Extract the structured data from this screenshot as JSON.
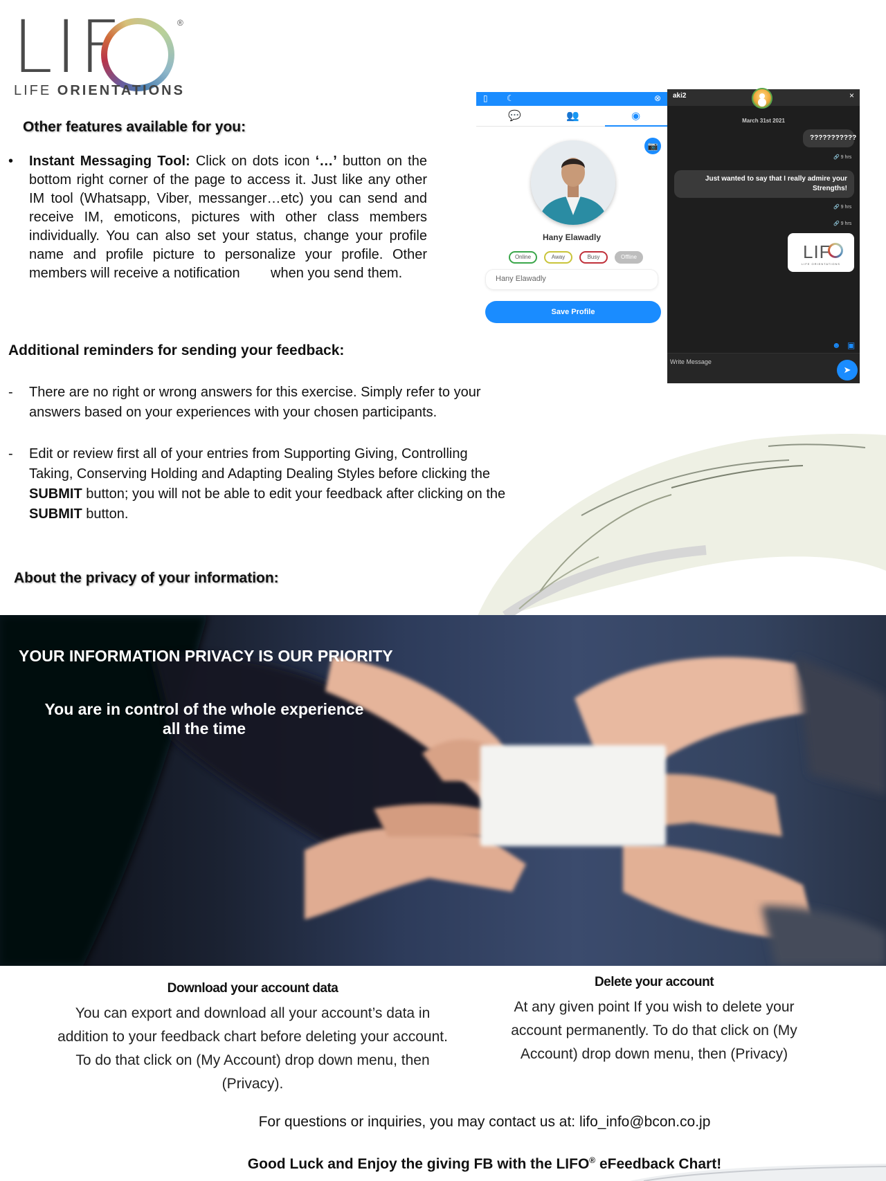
{
  "logo": {
    "letters": "LIF",
    "registered": "®",
    "subtitle_light": "LIFE ",
    "subtitle_bold": "ORIENTATIONS"
  },
  "features": {
    "title": "Other features available for you:",
    "bullet": "•",
    "im_label": "Instant Messaging Tool:",
    "im_text_1": " Click on dots icon  ",
    "im_dots": "‘…’",
    "im_text_2": " button on the bottom right corner of the page to access it. Just like any other IM tool (Whatsapp, Viber, messanger…etc) you can send and receive IM, emoticons, pictures with other class members individually. You can also set your status, change your profile name and profile picture to personalize your profile. Other members will receive a notification        when you send them."
  },
  "profile_mock": {
    "name": "Hany Elawadly",
    "statuses": [
      "Online",
      "Away",
      "Busy",
      "Offline"
    ],
    "status_colors": [
      "#3aa64a",
      "#c9c43a",
      "#c0303a",
      "#9a9a9a"
    ],
    "input_value": "Hany Elawadly",
    "save_label": "Save Profile",
    "icons": [
      "phone-icon",
      "moon-icon",
      "close-icon",
      "chat-icon",
      "group-icon",
      "profile-icon",
      "camera-icon"
    ]
  },
  "chat_mock": {
    "user": "aki2",
    "close": "×",
    "date": "March 31st 2021",
    "msg1": "???????????",
    "msg1_time": "9 hrs",
    "msg2": "Just wanted to say that I really admire your Strengths!",
    "msg2_time": "9 hrs",
    "msg3_time": "9 hrs",
    "logo_mini": "LIF",
    "logo_mini_sub": "LIFE ORIENTATIONS",
    "write_placeholder": "Write Message"
  },
  "reminders": {
    "title": "Additional reminders for sending your feedback:",
    "dash": "-",
    "item1": "There are no right or wrong answers for this exercise. Simply refer to your answers based on your experiences with your chosen participants.",
    "item2_a": "Edit or review first all of your entries from Supporting Giving, Controlling Taking, Conserving Holding and Adapting Dealing Styles before clicking the ",
    "item2_submit1": "SUBMIT",
    "item2_b": " button; you will not be able to edit your feedback after clicking on  the ",
    "item2_submit2": "SUBMIT",
    "item2_c": " button."
  },
  "privacy": {
    "title": "About the privacy of your information:",
    "hero_title": "YOUR INFORMATION PRIVACY IS OUR PRIORITY",
    "hero_sub": "You  are in control of the whole experience all the time"
  },
  "download": {
    "title": "Download your account data",
    "text": "You can export and download all your account’s data in addition to your feedback chart before deleting your account. To do that click on (My Account) drop down menu, then (Privacy)."
  },
  "delete": {
    "title": "Delete your account",
    "text": "At any given point If you wish to delete your account permanently. To do that click on (My Account) drop down menu, then (Privacy)"
  },
  "contact": "For questions or inquiries, you may contact us at: lifo_info@bcon.co.jp",
  "closing": {
    "a": "Good Luck and Enjoy the giving FB with the LIFO",
    "reg": "®",
    "b": " eFeedback Chart!"
  },
  "colors": {
    "accent_blue": "#1a8cff",
    "chat_dark": "#1e1e1e",
    "text": "#111111"
  }
}
